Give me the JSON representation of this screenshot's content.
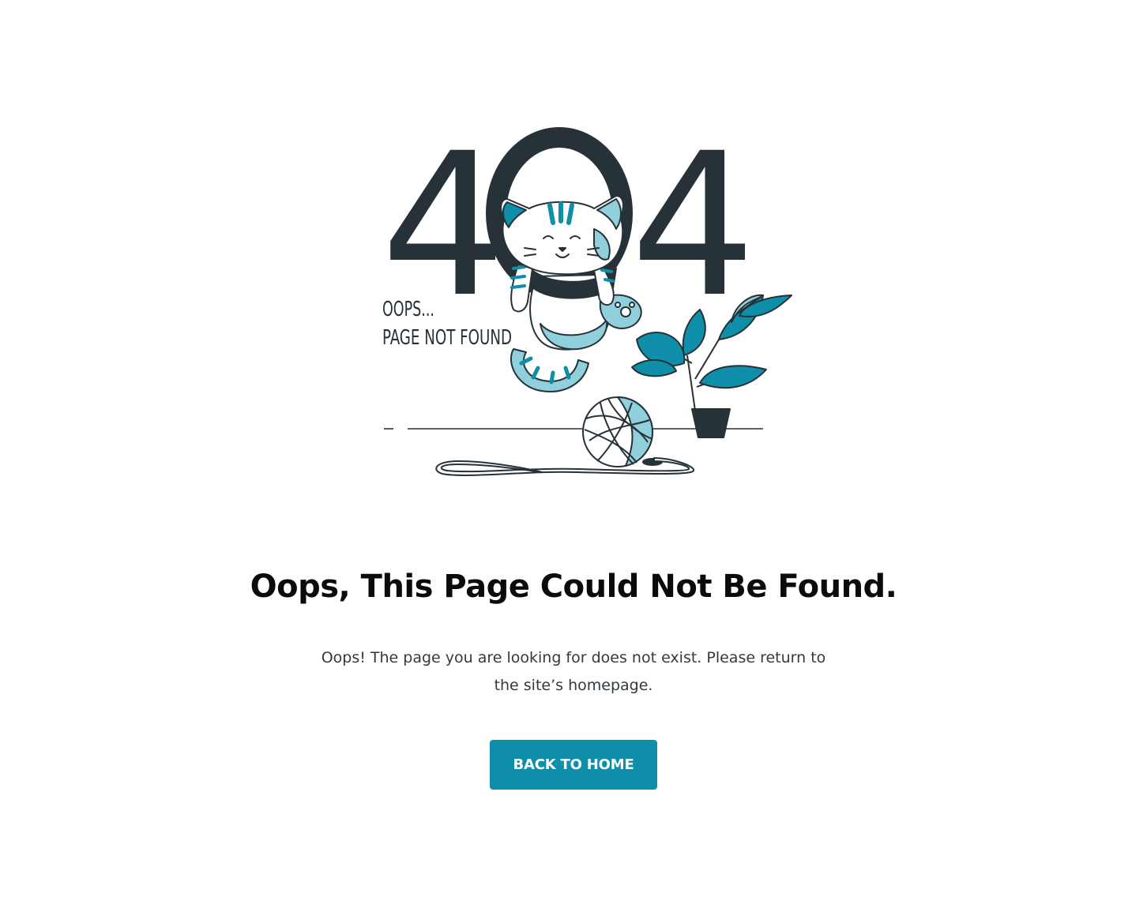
{
  "illustration": {
    "big_text": "404",
    "digit_left": "4",
    "digit_right": "4",
    "line1": "OOPS...",
    "line2": "PAGE NOT FOUND",
    "icon": "cat-404-illustration",
    "colors": {
      "dark": "#263238",
      "accent": "#0e8ea8",
      "accent_light": "#8fd0dc"
    }
  },
  "title": "Oops, This Page Could Not Be Found.",
  "description": "Oops! The page you are looking for does not exist. Please return to the site’s homepage.",
  "button": {
    "label": "BACK TO HOME",
    "color": "#0e8ea8"
  }
}
